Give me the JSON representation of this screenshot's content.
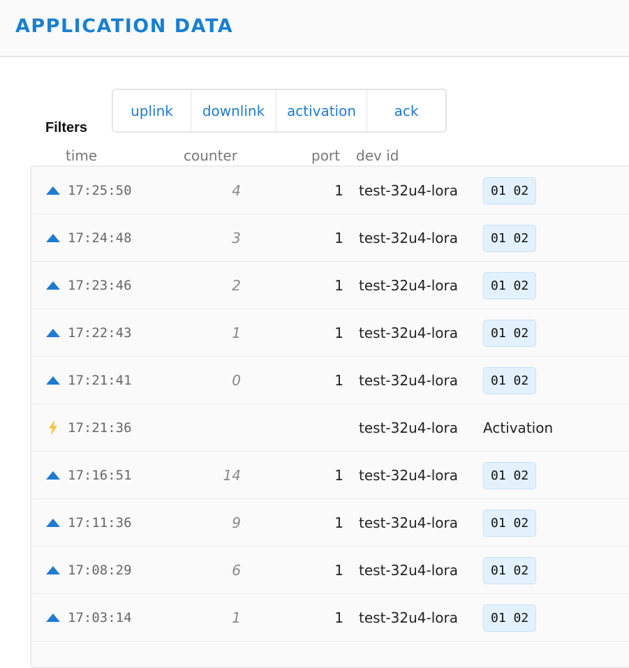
{
  "header": {
    "title": "APPLICATION DATA"
  },
  "filters": {
    "label": "Filters",
    "buttons": [
      {
        "label": "uplink"
      },
      {
        "label": "downlink"
      },
      {
        "label": "activation"
      },
      {
        "label": "ack"
      }
    ]
  },
  "columns": {
    "time": "time",
    "counter": "counter",
    "port": "port",
    "dev_id": "dev id"
  },
  "colors": {
    "accent": "#1a7fd1",
    "uplink_icon": "#1f7bd0",
    "activation_icon": "#f6c343",
    "payload_bg": "#e3f1fd"
  },
  "rows": [
    {
      "type": "uplink",
      "icon": "triangle-up-icon",
      "time": "17:25:50",
      "counter": "4",
      "port": "1",
      "dev_id": "test-32u4-lora",
      "payload": "01 02"
    },
    {
      "type": "uplink",
      "icon": "triangle-up-icon",
      "time": "17:24:48",
      "counter": "3",
      "port": "1",
      "dev_id": "test-32u4-lora",
      "payload": "01 02"
    },
    {
      "type": "uplink",
      "icon": "triangle-up-icon",
      "time": "17:23:46",
      "counter": "2",
      "port": "1",
      "dev_id": "test-32u4-lora",
      "payload": "01 02"
    },
    {
      "type": "uplink",
      "icon": "triangle-up-icon",
      "time": "17:22:43",
      "counter": "1",
      "port": "1",
      "dev_id": "test-32u4-lora",
      "payload": "01 02"
    },
    {
      "type": "uplink",
      "icon": "triangle-up-icon",
      "time": "17:21:41",
      "counter": "0",
      "port": "1",
      "dev_id": "test-32u4-lora",
      "payload": "01 02"
    },
    {
      "type": "activation",
      "icon": "lightning-bolt-icon",
      "time": "17:21:36",
      "counter": "",
      "port": "",
      "dev_id": "test-32u4-lora",
      "payload": "Activation"
    },
    {
      "type": "uplink",
      "icon": "triangle-up-icon",
      "time": "17:16:51",
      "counter": "14",
      "port": "1",
      "dev_id": "test-32u4-lora",
      "payload": "01 02"
    },
    {
      "type": "uplink",
      "icon": "triangle-up-icon",
      "time": "17:11:36",
      "counter": "9",
      "port": "1",
      "dev_id": "test-32u4-lora",
      "payload": "01 02"
    },
    {
      "type": "uplink",
      "icon": "triangle-up-icon",
      "time": "17:08:29",
      "counter": "6",
      "port": "1",
      "dev_id": "test-32u4-lora",
      "payload": "01 02"
    },
    {
      "type": "uplink",
      "icon": "triangle-up-icon",
      "time": "17:03:14",
      "counter": "1",
      "port": "1",
      "dev_id": "test-32u4-lora",
      "payload": "01 02"
    }
  ]
}
